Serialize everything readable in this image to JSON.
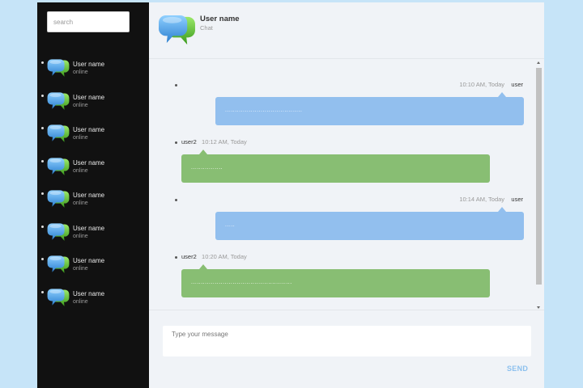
{
  "colors": {
    "sidebar_bg": "#111111",
    "main_bg": "#f0f3f7",
    "page_bg": "#c6e4f8",
    "sent_bubble": "#92bfee",
    "received_bubble": "#88be73",
    "send_accent": "#8cc0ee"
  },
  "sidebar": {
    "search_placeholder": "search",
    "contacts": [
      {
        "name": "User name",
        "status": "online",
        "icon": "chat-bubbles-icon"
      },
      {
        "name": "User name",
        "status": "online",
        "icon": "chat-bubbles-icon"
      },
      {
        "name": "User name",
        "status": "online",
        "icon": "chat-bubbles-icon"
      },
      {
        "name": "User name",
        "status": "online",
        "icon": "chat-bubbles-icon"
      },
      {
        "name": "User name",
        "status": "online",
        "icon": "chat-bubbles-icon"
      },
      {
        "name": "User name",
        "status": "online",
        "icon": "chat-bubbles-icon"
      },
      {
        "name": "User name",
        "status": "online",
        "icon": "chat-bubbles-icon"
      },
      {
        "name": "User name",
        "status": "online",
        "icon": "chat-bubbles-icon"
      }
    ]
  },
  "header": {
    "title": "User name",
    "subtitle": "Chat",
    "icon": "chat-bubbles-icon"
  },
  "messages": [
    {
      "direction": "sent",
      "time": "10:10 AM, Today",
      "user": "user",
      "text": "......................................."
    },
    {
      "direction": "received",
      "time": "10:12 AM, Today",
      "user": "user2",
      "text": "................"
    },
    {
      "direction": "sent",
      "time": "10:14 AM, Today",
      "user": "user",
      "text": "....."
    },
    {
      "direction": "received",
      "time": "10:20 AM, Today",
      "user": "user2",
      "text": "..................................................."
    }
  ],
  "composer": {
    "placeholder": "Type your message",
    "send_label": "SEND"
  }
}
